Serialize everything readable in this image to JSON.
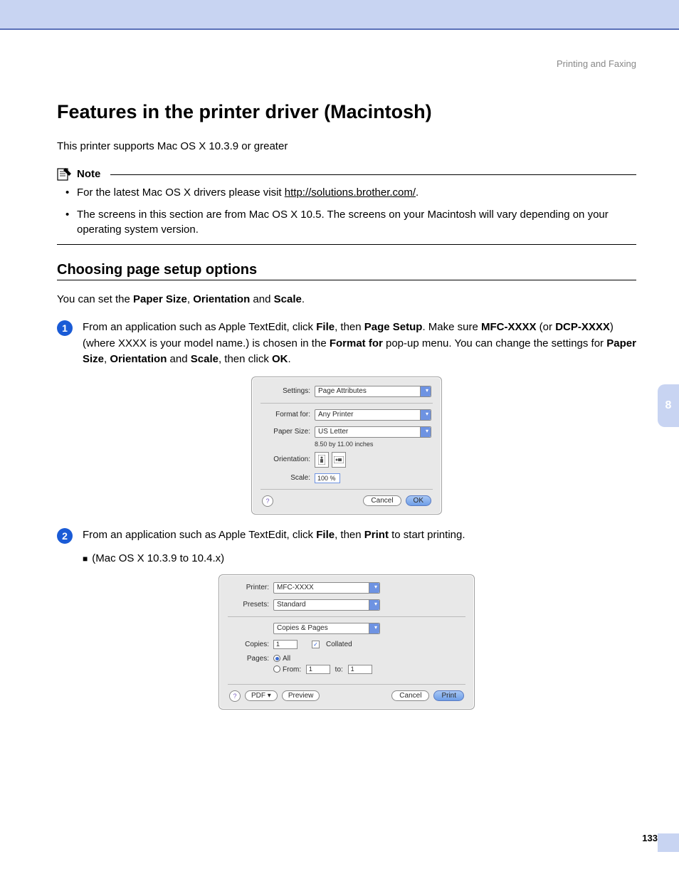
{
  "header": {
    "section": "Printing and Faxing"
  },
  "title": "Features in the printer driver (Macintosh)",
  "intro": "This printer supports Mac OS X 10.3.9 or greater",
  "note": {
    "label": "Note",
    "item1_prefix": "For the latest Mac OS X drivers please visit ",
    "item1_link": "http://solutions.brother.com/",
    "item1_suffix": ".",
    "item2": "The screens in this section are from Mac OS X 10.5. The screens on your Macintosh will vary depending on your operating system version."
  },
  "subhead": "Choosing page setup options",
  "settext": {
    "pre1": "You can set the ",
    "b1": "Paper Size",
    "sep1": ", ",
    "b2": "Orientation",
    "sep2": " and ",
    "b3": "Scale",
    "post": "."
  },
  "step1": {
    "num": "1",
    "t1": "From an application such as Apple TextEdit, click ",
    "b1": "File",
    "t2": ", then ",
    "b2": "Page Setup",
    "t3": ". Make sure ",
    "b3": "MFC-XXXX",
    "t4": " (or ",
    "b4": "DCP-XXXX",
    "t5": ") (where XXXX is your model name.) is chosen in the ",
    "b5": "Format for",
    "t6": " pop-up menu. You can change the settings for ",
    "b6": "Paper Size",
    "t7": ", ",
    "b7": "Orientation",
    "t8": " and ",
    "b8": "Scale",
    "t9": ", then click ",
    "b9": "OK",
    "t10": "."
  },
  "dialog1": {
    "settings_label": "Settings:",
    "settings_value": "Page Attributes",
    "format_label": "Format for:",
    "format_value": "Any Printer",
    "paper_label": "Paper Size:",
    "paper_value": "US Letter",
    "paper_dim": "8.50 by 11.00 inches",
    "orient_label": "Orientation:",
    "scale_label": "Scale:",
    "scale_value": "100 %",
    "cancel": "Cancel",
    "ok": "OK"
  },
  "step2": {
    "num": "2",
    "t1": "From an application such as Apple TextEdit, click ",
    "b1": "File",
    "t2": ", then ",
    "b2": "Print",
    "t3": " to start printing."
  },
  "subbullet": "(Mac OS X 10.3.9 to 10.4.x)",
  "dialog2": {
    "printer_label": "Printer:",
    "printer_value": "MFC-XXXX",
    "presets_label": "Presets:",
    "presets_value": "Standard",
    "section_value": "Copies & Pages",
    "copies_label": "Copies:",
    "copies_value": "1",
    "collated": "Collated",
    "pages_label": "Pages:",
    "all": "All",
    "from_label": "From:",
    "from_value": "1",
    "to_label": "to:",
    "to_value": "1",
    "pdf": "PDF ▾",
    "preview": "Preview",
    "cancel": "Cancel",
    "print": "Print"
  },
  "sidetab": "8",
  "pagenum": "133"
}
